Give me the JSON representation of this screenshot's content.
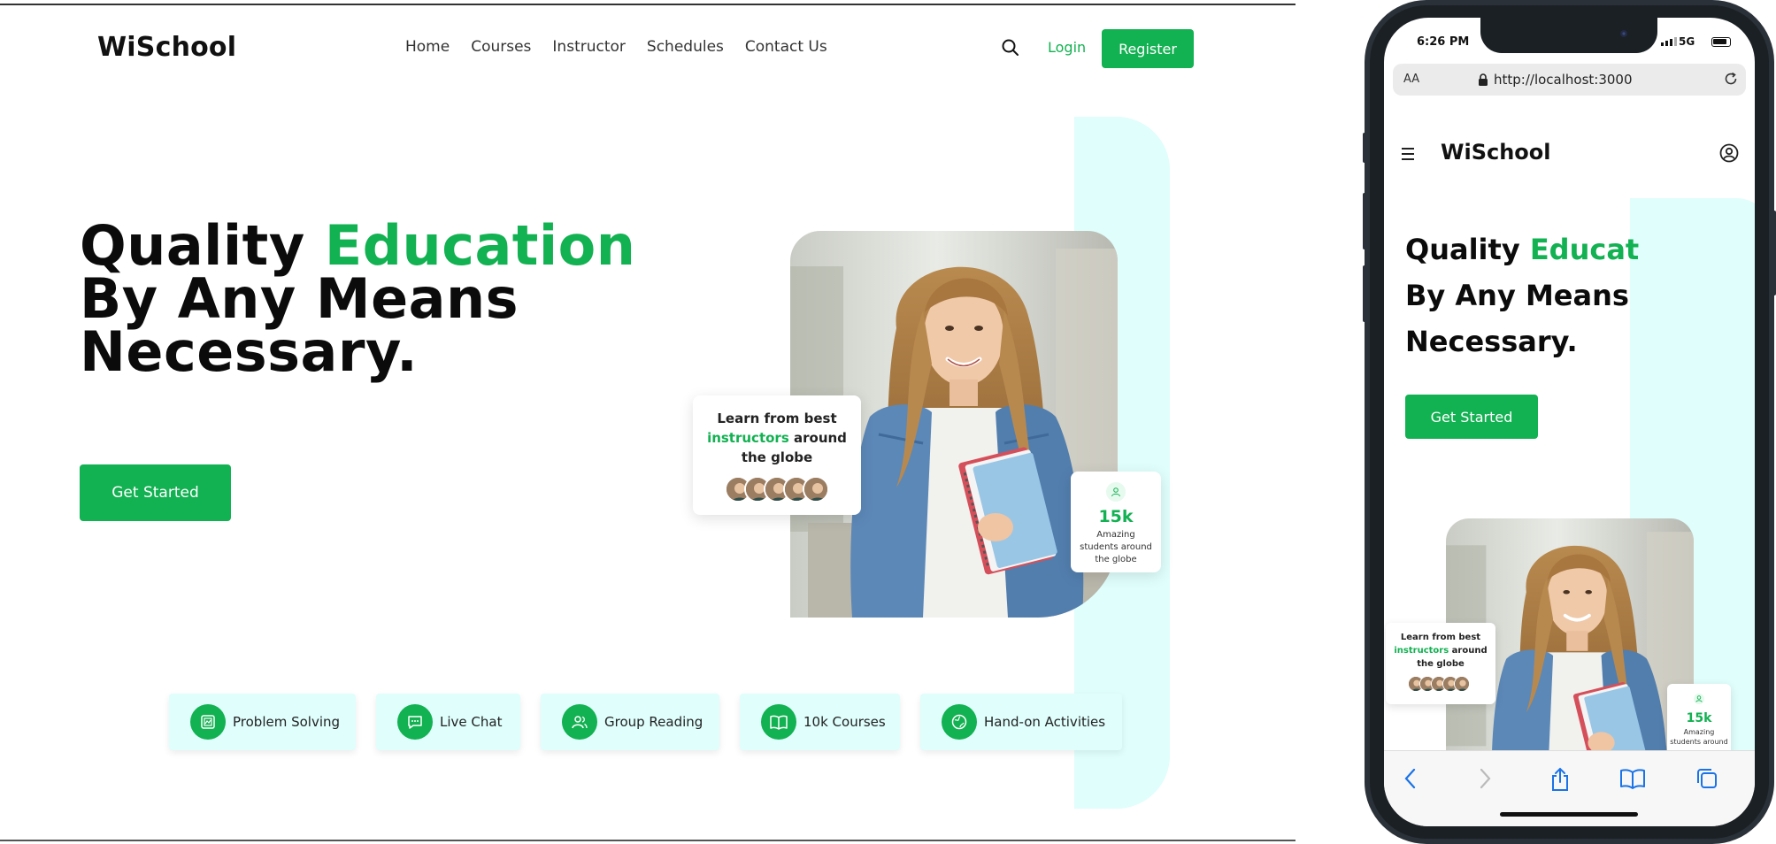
{
  "desktop": {
    "logo": "WiSchool",
    "nav": [
      "Home",
      "Courses",
      "Instructor",
      "Schedules",
      "Contact Us"
    ],
    "login_label": "Login",
    "register_label": "Register",
    "hero": {
      "title_part1": "Quality ",
      "title_accent": "Education",
      "title_line2": "By Any Means",
      "title_line3": "Necessary.",
      "cta_label": "Get Started"
    },
    "learn_card": {
      "line1": "Learn from best",
      "accent": "instructors",
      "line2_rest": " around",
      "line3": "the globe"
    },
    "stat_card": {
      "value": "15k",
      "label_line1": "Amazing",
      "label_line2": "students around",
      "label_line3": "the globe"
    },
    "features": [
      {
        "label": "Problem Solving",
        "icon": "problem-solving-icon"
      },
      {
        "label": "Live Chat",
        "icon": "chat-icon"
      },
      {
        "label": "Group Reading",
        "icon": "group-icon"
      },
      {
        "label": "10k Courses",
        "icon": "book-icon"
      },
      {
        "label": "Hand-on Activities",
        "icon": "activities-icon"
      }
    ]
  },
  "phone": {
    "status": {
      "time": "6:26 PM",
      "network": "5G"
    },
    "browser": {
      "text_size": "AA",
      "url": "http://localhost:3000"
    },
    "logo": "WiSchool",
    "hero": {
      "title_part1": "Quality ",
      "title_accent": "Educat",
      "title_line2": "By Any Means",
      "title_line3": "Necessary.",
      "cta_label": "Get Started"
    },
    "learn_card": {
      "line1": "Learn from best",
      "accent": "instructors",
      "line2_rest": " around",
      "line3": "the globe"
    },
    "stat_card": {
      "value": "15k",
      "label_line1": "Amazing",
      "label_line2": "students around"
    }
  },
  "colors": {
    "accent": "#12b151",
    "stripe": "#dffefc",
    "text": "#111111"
  }
}
